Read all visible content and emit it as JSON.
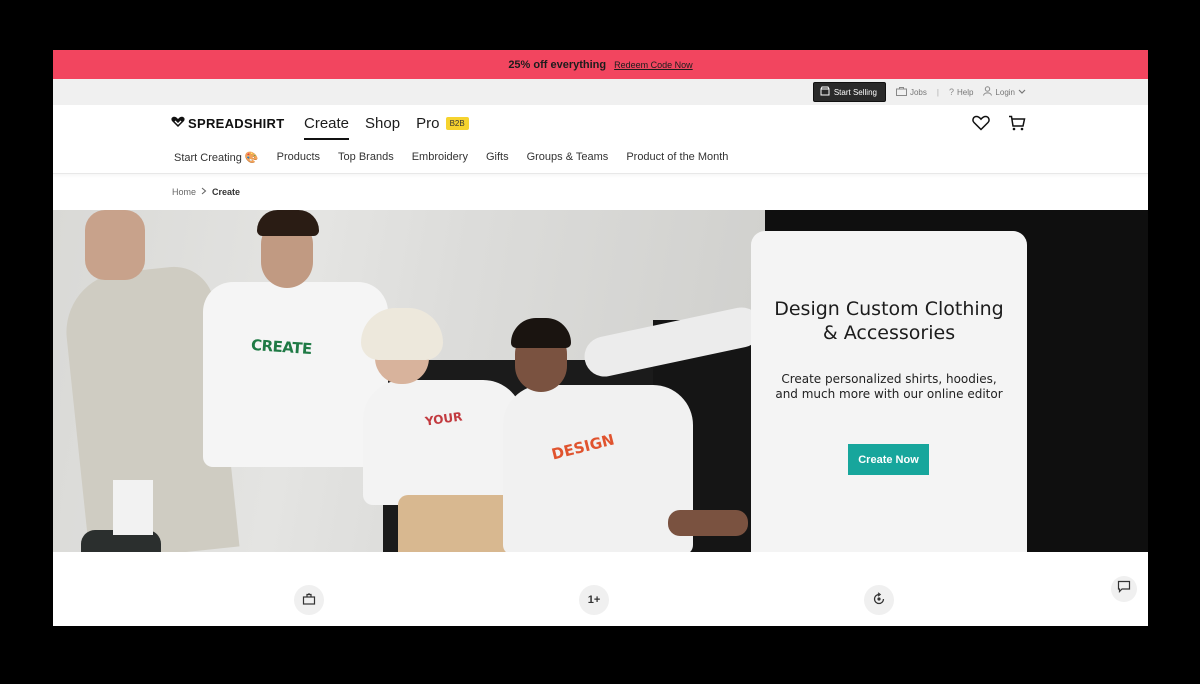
{
  "promo": {
    "offer": "25% off everything",
    "link": "Redeem Code Now"
  },
  "utility": {
    "start_selling": "Start Selling",
    "jobs": "Jobs",
    "help": "Help",
    "login": "Login"
  },
  "brand": {
    "name": "SPREADSHIRT"
  },
  "primary_tabs": [
    {
      "label": "Create",
      "active": true
    },
    {
      "label": "Shop",
      "active": false
    },
    {
      "label": "Pro",
      "active": false,
      "badge": "B2B"
    }
  ],
  "subnav": [
    "Start Creating 🎨",
    "Products",
    "Top Brands",
    "Embroidery",
    "Gifts",
    "Groups & Teams",
    "Product of the Month"
  ],
  "breadcrumb": {
    "home": "Home",
    "current": "Create"
  },
  "hero": {
    "title_line1": "Design Custom Clothing",
    "title_line2": "& Accessories",
    "subtitle": "Create personalized shirts, hoodies, and much more with our online editor",
    "cta": "Create Now",
    "shirt_words": [
      "CREATE",
      "YOUR",
      "DESIGN"
    ]
  },
  "features": [
    {
      "icon": "toolbox-icon"
    },
    {
      "label": "1+"
    },
    {
      "icon": "rotate-icon"
    }
  ],
  "colors": {
    "promo": "#f2455f",
    "cta": "#17a69c",
    "badge": "#f6d32e"
  }
}
